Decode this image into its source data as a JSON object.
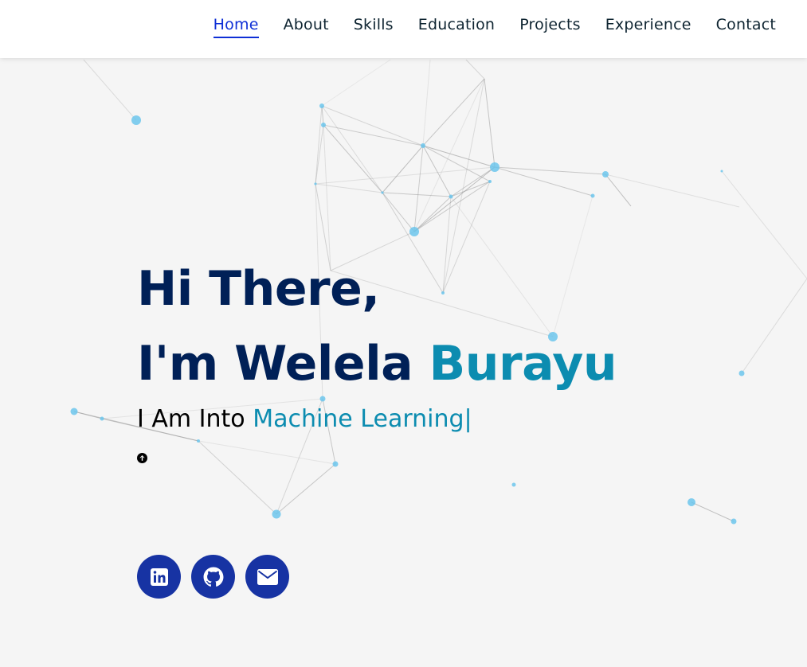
{
  "nav": {
    "items": [
      {
        "label": "Home",
        "active": true
      },
      {
        "label": "About",
        "active": false
      },
      {
        "label": "Skills",
        "active": false
      },
      {
        "label": "Education",
        "active": false
      },
      {
        "label": "Projects",
        "active": false
      },
      {
        "label": "Experience",
        "active": false
      },
      {
        "label": "Contact",
        "active": false
      }
    ]
  },
  "hero": {
    "greeting": "Hi There,",
    "intro": "I'm Welela ",
    "name_highlight": "Burayu",
    "typing_prefix": "I Am Into ",
    "typing_role": "Machine Learning",
    "typing_cursor": "|"
  },
  "icons": {
    "scroll_top": "arrow-up-circle-icon",
    "socials": [
      "linkedin-icon",
      "github-icon",
      "email-icon"
    ]
  },
  "colors": {
    "page_bg": "#f5f5f5",
    "nav_active": "#0e2fd6",
    "heading": "#002057",
    "accent": "#0c8cb0",
    "social_bg": "#1733a3",
    "particle": "#6cc6ec",
    "link_line": "#9a9a9a"
  }
}
